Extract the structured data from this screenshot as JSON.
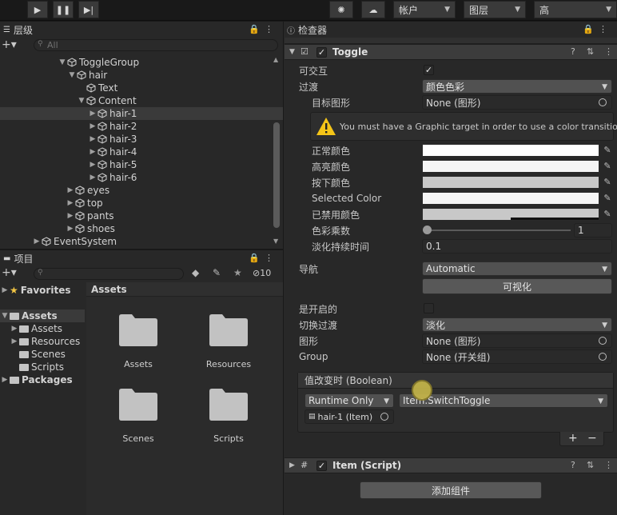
{
  "toolbar": {
    "account": "帐户",
    "layers": "图层",
    "layout": "高"
  },
  "hierarchy": {
    "tab": "层级",
    "search_placeholder": "All",
    "items": [
      {
        "label": "ToggleGroup",
        "indent": 72,
        "fold": "▼"
      },
      {
        "label": "hair",
        "indent": 84,
        "fold": "▼"
      },
      {
        "label": "Text",
        "indent": 96,
        "fold": ""
      },
      {
        "label": "Content",
        "indent": 96,
        "fold": "▼"
      },
      {
        "label": "hair-1",
        "indent": 110,
        "fold": "▶",
        "selected": true
      },
      {
        "label": "hair-2",
        "indent": 110,
        "fold": "▶"
      },
      {
        "label": "hair-3",
        "indent": 110,
        "fold": "▶"
      },
      {
        "label": "hair-4",
        "indent": 110,
        "fold": "▶"
      },
      {
        "label": "hair-5",
        "indent": 110,
        "fold": "▶"
      },
      {
        "label": "hair-6",
        "indent": 110,
        "fold": "▶"
      },
      {
        "label": "eyes",
        "indent": 82,
        "fold": "▶"
      },
      {
        "label": "top",
        "indent": 82,
        "fold": "▶"
      },
      {
        "label": "pants",
        "indent": 82,
        "fold": "▶"
      },
      {
        "label": "shoes",
        "indent": 82,
        "fold": "▶"
      },
      {
        "label": "EventSystem",
        "indent": 40,
        "fold": "▶"
      }
    ]
  },
  "project": {
    "tab": "项目",
    "hidden_count": "10",
    "tree": [
      {
        "label": "Favorites",
        "indent": 0,
        "fold": "▶",
        "bold": true,
        "icon": "star"
      },
      {
        "label": "Assets",
        "indent": 0,
        "fold": "▼",
        "bold": true,
        "icon": "folder",
        "selected": true
      },
      {
        "label": "Assets",
        "indent": 12,
        "fold": "▶",
        "icon": "folder"
      },
      {
        "label": "Resources",
        "indent": 12,
        "fold": "▶",
        "icon": "folder"
      },
      {
        "label": "Scenes",
        "indent": 12,
        "fold": "",
        "icon": "folder"
      },
      {
        "label": "Scripts",
        "indent": 12,
        "fold": "",
        "icon": "folder"
      },
      {
        "label": "Packages",
        "indent": 0,
        "fold": "▶",
        "bold": true,
        "icon": "folder"
      }
    ],
    "breadcrumb": "Assets",
    "grid": [
      "Assets",
      "Resources",
      "Scenes",
      "Scripts"
    ]
  },
  "inspector": {
    "tab": "检查器",
    "component": "Toggle",
    "interactable_label": "可交互",
    "transition_label": "过渡",
    "transition_value": "颜色色彩",
    "target_graphic_label": "目标图形",
    "target_graphic_value": "None (图形)",
    "warning": "You must have a Graphic target in order to use a color transition.",
    "normal_color": "正常颜色",
    "highlighted_color": "高亮颜色",
    "pressed_color": "按下颜色",
    "selected_color": "Selected Color",
    "disabled_color": "已禁用颜色",
    "color_multiplier_label": "色彩乘数",
    "color_multiplier_value": "1",
    "fade_duration_label": "淡化持续时间",
    "fade_duration_value": "0.1",
    "navigation_label": "导航",
    "navigation_value": "Automatic",
    "visualize": "可视化",
    "is_on_label": "是开启的",
    "toggle_transition_label": "切换过渡",
    "toggle_transition_value": "淡化",
    "graphic_label": "图形",
    "graphic_value": "None (图形)",
    "group_label": "Group",
    "group_value": "None (开关组)",
    "event_header": "值改变时 (Boolean)",
    "runtime": "Runtime Only",
    "function": "Item.SwitchToggle",
    "object": "hair-1 (Item)",
    "plus": "+",
    "minus": "−",
    "script_component": "Item (Script)",
    "add_component": "添加组件",
    "colors": {
      "normal": "#ffffff",
      "highlighted": "#f5f5f5",
      "pressed": "#c8c8c8",
      "selected": "#f5f5f5",
      "disabled": "#c8c8c8"
    }
  }
}
